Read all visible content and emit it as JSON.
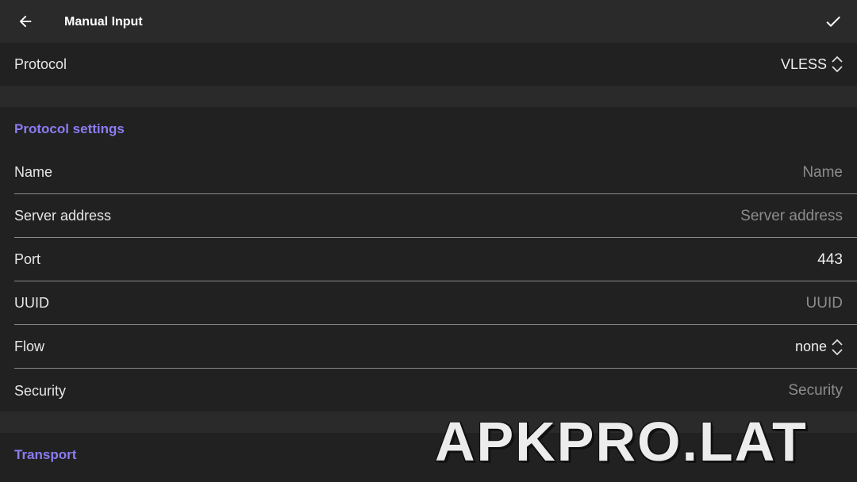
{
  "appbar": {
    "title": "Manual Input",
    "back_icon": "arrow-left-icon",
    "confirm_icon": "check-icon"
  },
  "protocol": {
    "label": "Protocol",
    "value": "VLESS"
  },
  "sections": {
    "protocol_settings": "Protocol settings",
    "transport": "Transport"
  },
  "fields": {
    "name": {
      "label": "Name",
      "placeholder": "Name"
    },
    "server_address": {
      "label": "Server address",
      "placeholder": "Server address"
    },
    "port": {
      "label": "Port",
      "value": "443"
    },
    "uuid": {
      "label": "UUID",
      "placeholder": "UUID"
    },
    "flow": {
      "label": "Flow",
      "value": "none"
    },
    "security": {
      "label": "Security",
      "placeholder": "Security"
    }
  },
  "watermark": "APKPRO.LAT",
  "colors": {
    "accent": "#8b7cf0",
    "background": "#212121",
    "appbar": "#2a2a2a"
  }
}
